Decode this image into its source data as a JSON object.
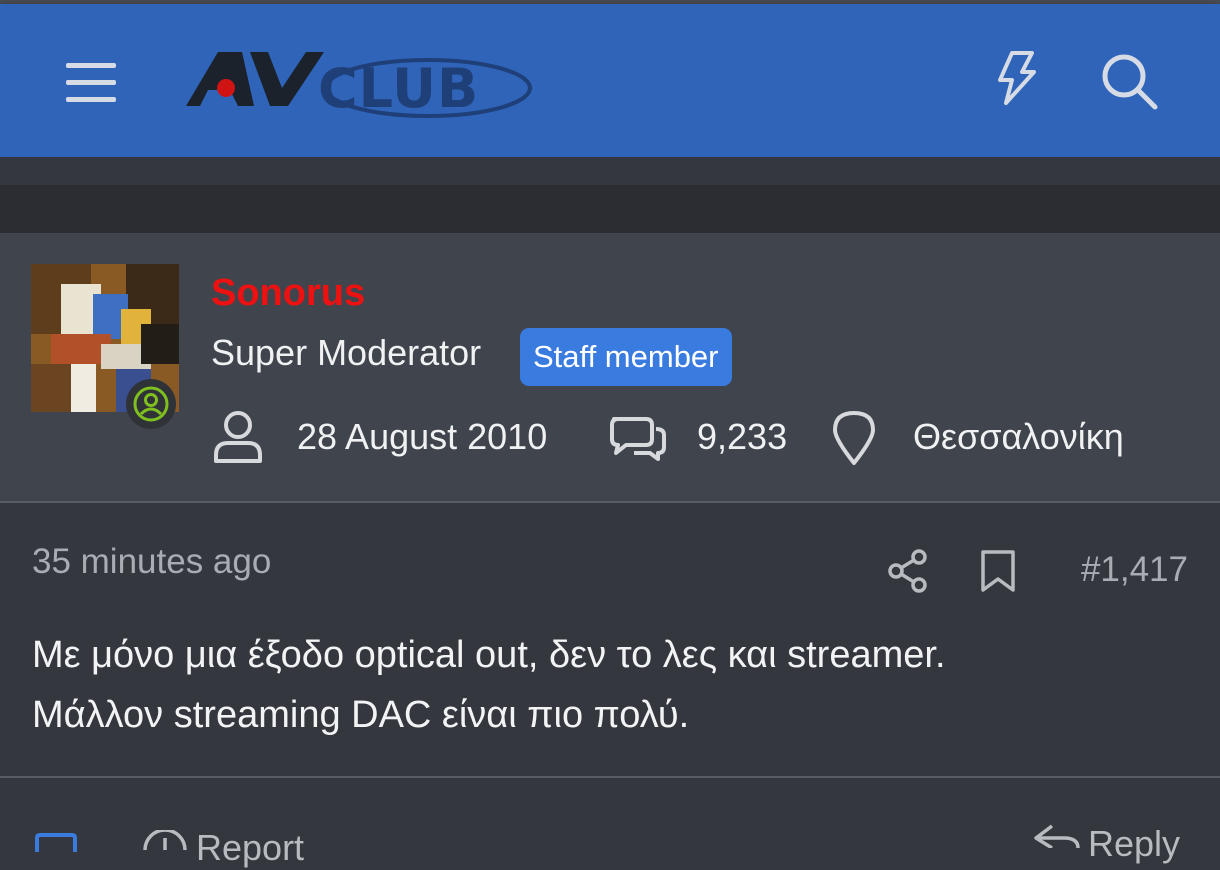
{
  "header": {
    "menu_icon": "hamburger-menu-icon",
    "logo_text_av": "AV",
    "logo_text_club": "CLUB",
    "whats_new_icon": "lightning-icon",
    "search_icon": "search-icon",
    "bar_color": "#2f64b9"
  },
  "user": {
    "name": "Sonorus",
    "name_color": "#ee1111",
    "title": "Super Moderator",
    "badge": "Staff member",
    "joined": "28 August 2010",
    "messages": "9,233",
    "location": "Θεσσαλονίκη",
    "online_icon": "online-user-icon"
  },
  "post": {
    "time": "35 minutes ago",
    "number": "#1,417",
    "share_icon": "share-icon",
    "bookmark_icon": "bookmark-icon",
    "body_lines": [
      "Με μόνο μια έξοδο optical out, δεν το λες και streamer.",
      "Μάλλον streaming DAC είναι πιο πολύ."
    ]
  },
  "footer": {
    "report_label": "Report",
    "reply_label": "Reply"
  }
}
